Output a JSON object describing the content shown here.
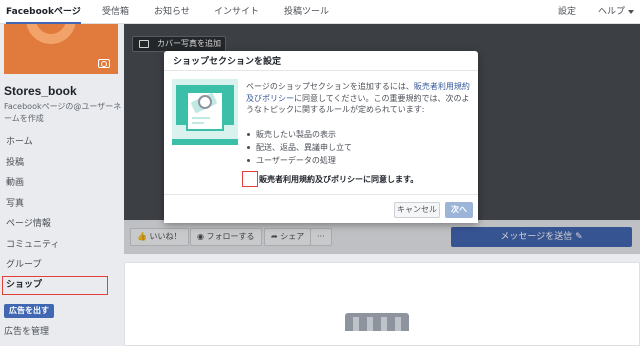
{
  "topbar": {
    "tabs": [
      "Facebookページ",
      "受信箱",
      "お知らせ",
      "インサイト",
      "投稿ツール"
    ],
    "settings": "設定",
    "help": "ヘルプ"
  },
  "left": {
    "page_name": "Stores_book",
    "page_handle": "Facebookページの@ユーザーネームを作成",
    "nav": [
      "ホーム",
      "投稿",
      "動画",
      "写真",
      "ページ情報",
      "コミュニティ",
      "グループ",
      "ショップ"
    ],
    "ad_button": "広告を出す",
    "ad_manage": "広告を管理"
  },
  "cover": {
    "add_cover": "カバー写真を追加"
  },
  "actions": {
    "like": "いいね！",
    "follow": "フォローする",
    "share": "シェア",
    "more": "···",
    "message": "メッセージを送信"
  },
  "modal": {
    "title": "ショップセクションを設定",
    "body_pre": "ページのショップセクションを追加するには、",
    "body_link": "販売者利用規約及びポリシー",
    "body_post": "に同意してください。この重要規約では、次のようなトピックに関するルールが定められています:",
    "bullets": [
      "販売したい製品の表示",
      "配送、返品、異議申し立て",
      "ユーザーデータの処理"
    ],
    "agree_label": "販売者利用規約及びポリシーに同意します。",
    "cancel": "キャンセル",
    "next": "次へ"
  }
}
